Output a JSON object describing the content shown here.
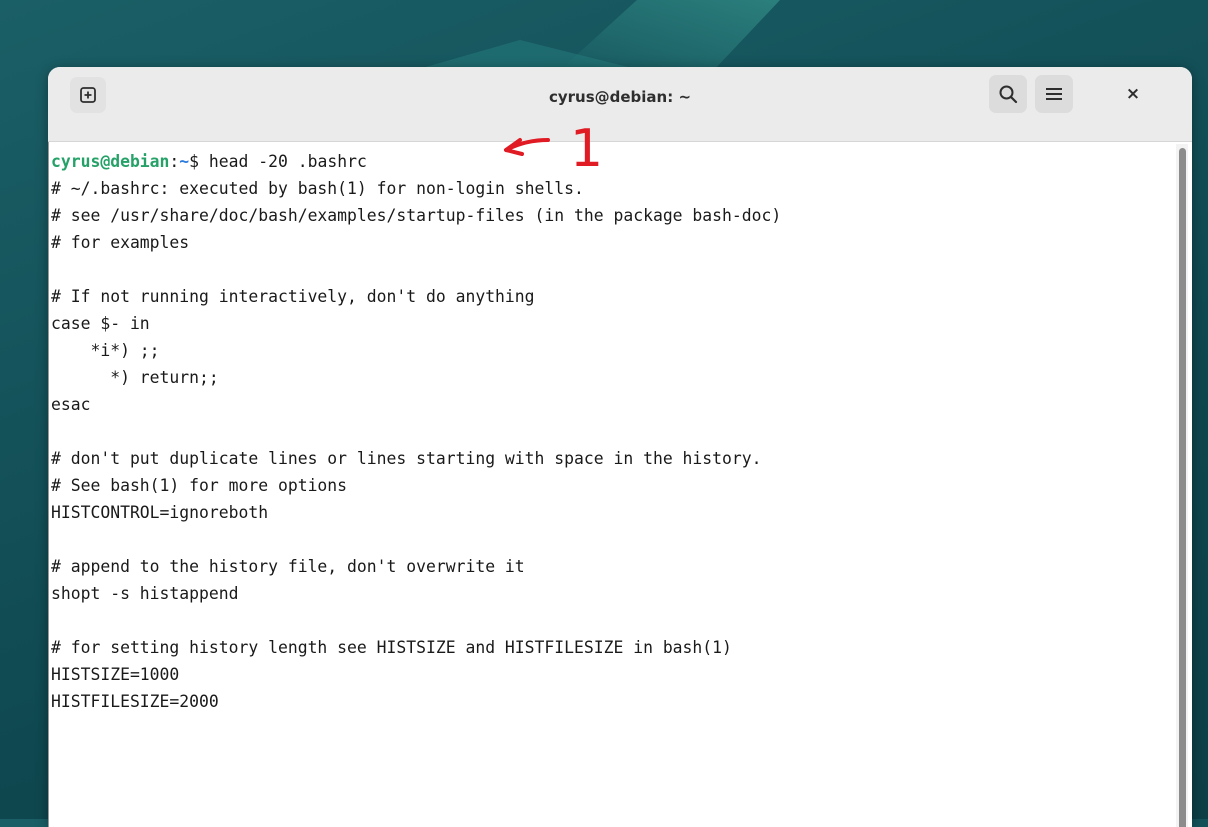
{
  "window": {
    "title": "cyrus@debian: ~"
  },
  "toolbar": {
    "new_tab_icon": "new-tab-icon",
    "search_icon": "search-icon",
    "menu_icon": "hamburger-menu-icon",
    "close_label": "×"
  },
  "prompt": {
    "user_host": "cyrus@debian",
    "sep": ":",
    "path": "~",
    "symbol": "$ ",
    "command": "head -20 .bashrc"
  },
  "output": [
    "# ~/.bashrc: executed by bash(1) for non-login shells.",
    "# see /usr/share/doc/bash/examples/startup-files (in the package bash-doc)",
    "# for examples",
    "",
    "# If not running interactively, don't do anything",
    "case $- in",
    "    *i*) ;;",
    "      *) return;;",
    "esac",
    "",
    "# don't put duplicate lines or lines starting with space in the history.",
    "# See bash(1) for more options",
    "HISTCONTROL=ignoreboth",
    "",
    "# append to the history file, don't overwrite it",
    "shopt -s histappend",
    "",
    "# for setting history length see HISTSIZE and HISTFILESIZE in bash(1)",
    "HISTSIZE=1000",
    "HISTFILESIZE=2000"
  ],
  "annotation": {
    "label": "1",
    "color": "#e01b24"
  },
  "colors": {
    "prompt_user": "#26a269",
    "prompt_path": "#2a7bde"
  }
}
